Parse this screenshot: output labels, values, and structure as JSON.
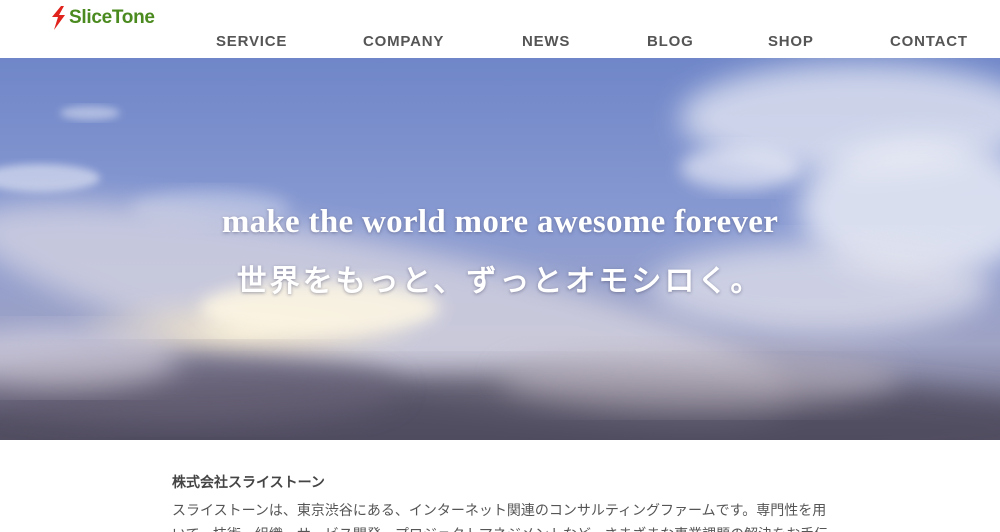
{
  "brand": {
    "name": "SliceTone",
    "logo_icon": "lightning-slice-icon",
    "colors": {
      "mark": "#e0231c",
      "text": "#4a8a1e"
    }
  },
  "nav": {
    "items": [
      {
        "label": "SERVICE"
      },
      {
        "label": "COMPANY"
      },
      {
        "label": "NEWS"
      },
      {
        "label": "BLOG"
      },
      {
        "label": "SHOP"
      },
      {
        "label": "CONTACT"
      }
    ]
  },
  "hero": {
    "title": "make the world more awesome forever",
    "subtitle": "世界をもっと、ずっとオモシロく。"
  },
  "intro": {
    "heading": "株式会社スライストーン",
    "body": "スライストーンは、東京渋谷にある、インターネット関連のコンサルティングファームです。専門性を用いて、技術、組織、サービス開発、プロジェクトマネジメントなど、さまざまな事業課題の解決をお手伝"
  }
}
